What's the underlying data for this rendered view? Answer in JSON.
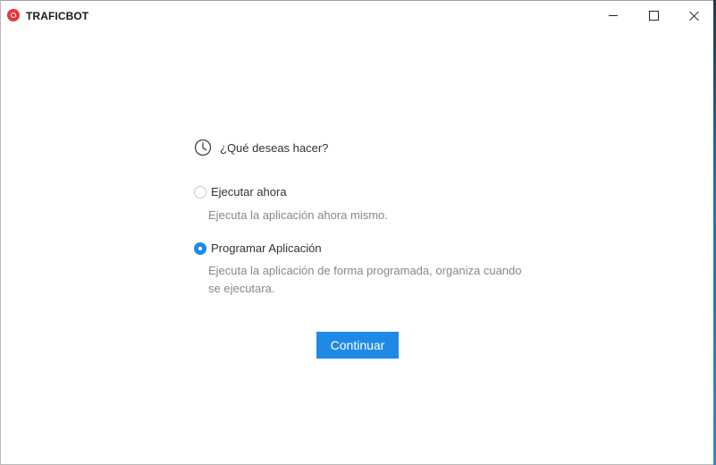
{
  "window": {
    "title": "TRAFICBOT",
    "controls": {
      "minimize_icon": "minimize-icon",
      "maximize_icon": "maximize-icon",
      "close_icon": "close-icon"
    }
  },
  "form": {
    "question": "¿Qué deseas hacer?",
    "question_icon": "clock-icon",
    "options": [
      {
        "label": "Ejecutar ahora",
        "description": "Ejecuta la aplicación ahora mismo.",
        "selected": false
      },
      {
        "label": "Programar Aplicación",
        "description": "Ejecuta la aplicación de forma programada, organiza cuando se ejecutara.",
        "selected": true
      }
    ],
    "submit_label": "Continuar"
  },
  "colors": {
    "accent": "#1e8ae6",
    "logo": "#e8383d",
    "text": "#333333",
    "muted_text": "#888888"
  }
}
